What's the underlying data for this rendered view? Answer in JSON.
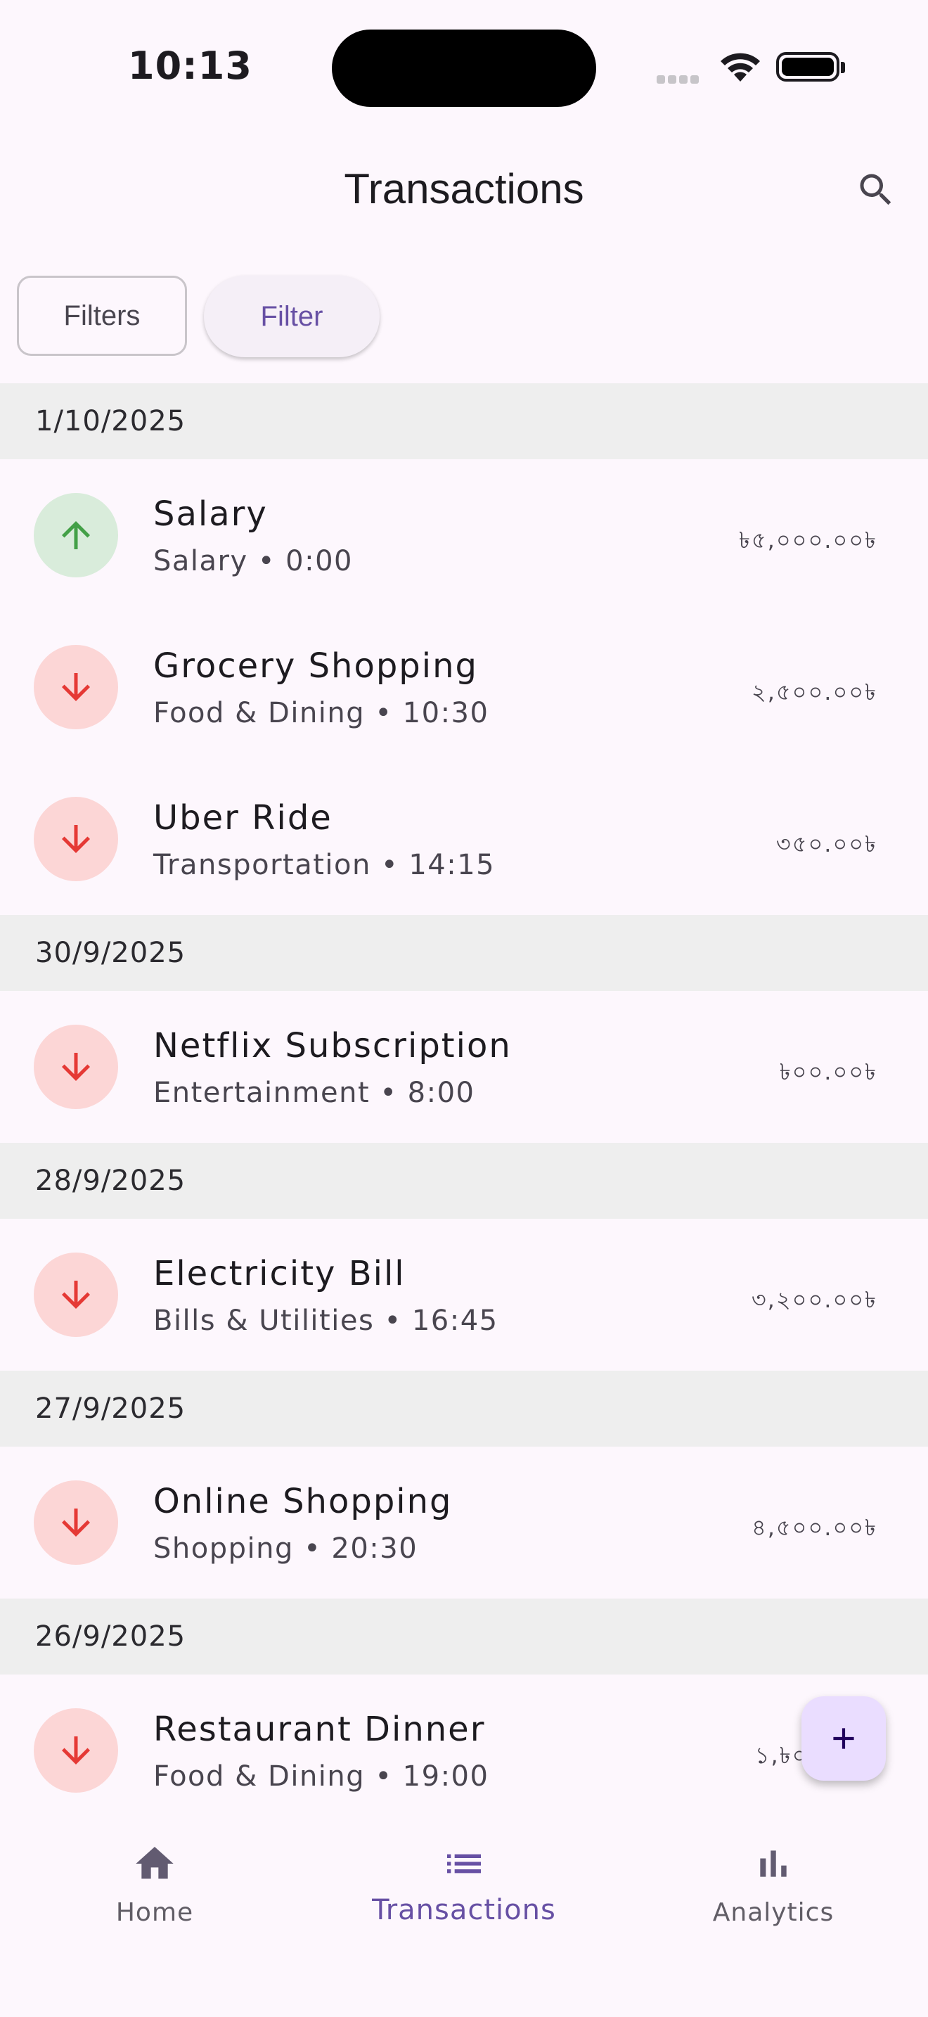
{
  "status_bar": {
    "time": "10:13"
  },
  "app_bar": {
    "title": "Transactions"
  },
  "filters": {
    "outlined_label": "Filters",
    "tonal_label": "Filter"
  },
  "groups": [
    {
      "date": "1/10/2025",
      "items": [
        {
          "name": "Salary",
          "subtitle": "Salary • 0:00",
          "amount": "৳৫,০০০.০০৳",
          "type": "income"
        },
        {
          "name": "Grocery Shopping",
          "subtitle": "Food & Dining • 10:30",
          "amount": "২,৫০০.০০৳",
          "type": "expense"
        },
        {
          "name": "Uber Ride",
          "subtitle": "Transportation • 14:15",
          "amount": "৩৫০.০০৳",
          "type": "expense"
        }
      ]
    },
    {
      "date": "30/9/2025",
      "items": [
        {
          "name": "Netflix Subscription",
          "subtitle": "Entertainment • 8:00",
          "amount": "৳০০.০০৳",
          "type": "expense"
        }
      ]
    },
    {
      "date": "28/9/2025",
      "items": [
        {
          "name": "Electricity Bill",
          "subtitle": "Bills & Utilities • 16:45",
          "amount": "৩,২০০.০০৳",
          "type": "expense"
        }
      ]
    },
    {
      "date": "27/9/2025",
      "items": [
        {
          "name": "Online Shopping",
          "subtitle": "Shopping • 20:30",
          "amount": "৪,৫০০.০০৳",
          "type": "expense"
        }
      ]
    },
    {
      "date": "26/9/2025",
      "items": [
        {
          "name": "Restaurant Dinner",
          "subtitle": "Food & Dining • 19:00",
          "amount": "১,৳০০.০০৳",
          "type": "expense"
        }
      ]
    }
  ],
  "nav": {
    "home": "Home",
    "transactions": "Transactions",
    "analytics": "Analytics"
  },
  "colors": {
    "income": "#43a047",
    "expense": "#e53935",
    "primary": "#6750a4"
  }
}
